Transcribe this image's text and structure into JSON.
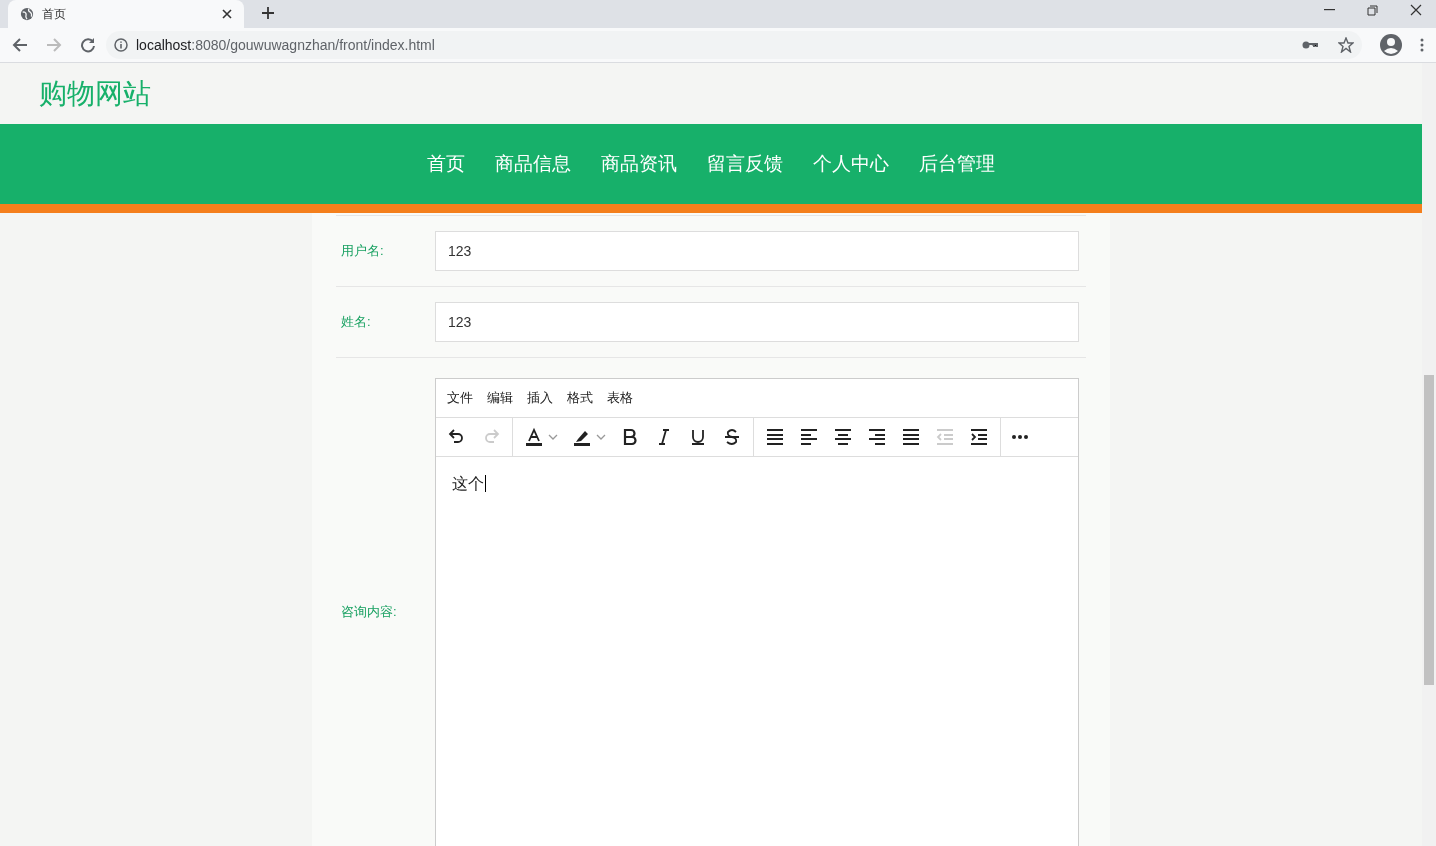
{
  "browser": {
    "tab_title": "首页",
    "url_host": "localhost",
    "url_rest": ":8080/gouwuwagnzhan/front/index.html"
  },
  "site": {
    "logo": "购物网站",
    "nav": [
      {
        "label": "首页"
      },
      {
        "label": "商品信息"
      },
      {
        "label": "商品资讯"
      },
      {
        "label": "留言反馈"
      },
      {
        "label": "个人中心"
      },
      {
        "label": "后台管理"
      }
    ]
  },
  "form": {
    "fields": [
      {
        "label": "用户名:",
        "value": "123"
      },
      {
        "label": "姓名:",
        "value": "123"
      }
    ],
    "editor": {
      "label": "咨询内容:",
      "menu": [
        "文件",
        "编辑",
        "插入",
        "格式",
        "表格"
      ],
      "toolbar": [
        {
          "kind": "undo",
          "disabled": false
        },
        {
          "kind": "redo",
          "disabled": true
        },
        {
          "kind": "sep"
        },
        {
          "kind": "textcolor",
          "disabled": false
        },
        {
          "kind": "highlight",
          "disabled": false
        },
        {
          "kind": "bold",
          "disabled": false
        },
        {
          "kind": "italic",
          "disabled": false
        },
        {
          "kind": "underline",
          "disabled": false
        },
        {
          "kind": "strike",
          "disabled": false
        },
        {
          "kind": "sep"
        },
        {
          "kind": "lineheight",
          "disabled": false
        },
        {
          "kind": "alignleft",
          "disabled": false
        },
        {
          "kind": "aligncenter",
          "disabled": false
        },
        {
          "kind": "alignright",
          "disabled": false
        },
        {
          "kind": "justify",
          "disabled": false
        },
        {
          "kind": "outdent",
          "disabled": true
        },
        {
          "kind": "indent",
          "disabled": false
        },
        {
          "kind": "sep"
        },
        {
          "kind": "more",
          "disabled": false
        }
      ],
      "content": "这个"
    }
  }
}
